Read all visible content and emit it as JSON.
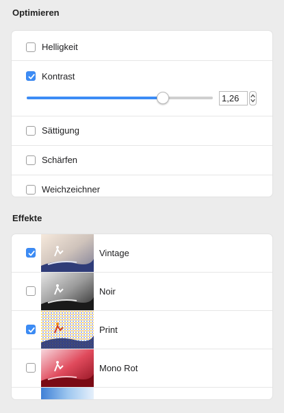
{
  "optimize": {
    "title": "Optimieren",
    "items": [
      {
        "label": "Helligkeit",
        "checked": false
      },
      {
        "label": "Kontrast",
        "checked": true
      },
      {
        "label": "Sättigung",
        "checked": false
      },
      {
        "label": "Schärfen",
        "checked": false
      },
      {
        "label": "Weichzeichner",
        "checked": false
      }
    ],
    "contrast_slider": {
      "value": "1,26",
      "fill_fraction": 0.73
    }
  },
  "effects": {
    "title": "Effekte",
    "items": [
      {
        "label": "Vintage",
        "checked": true
      },
      {
        "label": "Noir",
        "checked": false
      },
      {
        "label": "Print",
        "checked": true
      },
      {
        "label": "Mono Rot",
        "checked": false
      }
    ]
  },
  "colors": {
    "accent": "#3c8cf5",
    "background": "#ececec",
    "panel": "#ffffff",
    "divider": "#e6e6e6"
  }
}
